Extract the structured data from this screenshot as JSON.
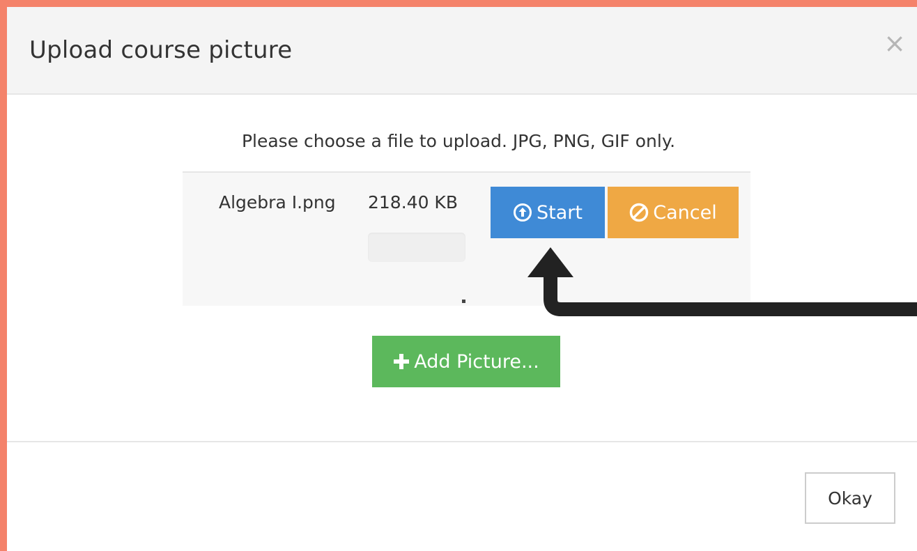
{
  "modal": {
    "title": "Upload course picture",
    "close_glyph": "×",
    "instructions": "Please choose a file to upload. JPG, PNG, GIF only."
  },
  "upload": {
    "file_name": "Algebra I.png",
    "file_size": "218.40 KB",
    "progress_percent": 0,
    "start_label": "Start",
    "cancel_label": "Cancel",
    "start_icon": "upload-circle-icon",
    "cancel_icon": "ban-icon"
  },
  "add_picture": {
    "label": "Add Picture...",
    "icon": "plus-icon"
  },
  "footer": {
    "okay_label": "Okay"
  },
  "colors": {
    "page_border": "#f4826a",
    "start": "#3f8ad6",
    "cancel": "#efa844",
    "add": "#5cb85c",
    "arrow": "#222222"
  }
}
